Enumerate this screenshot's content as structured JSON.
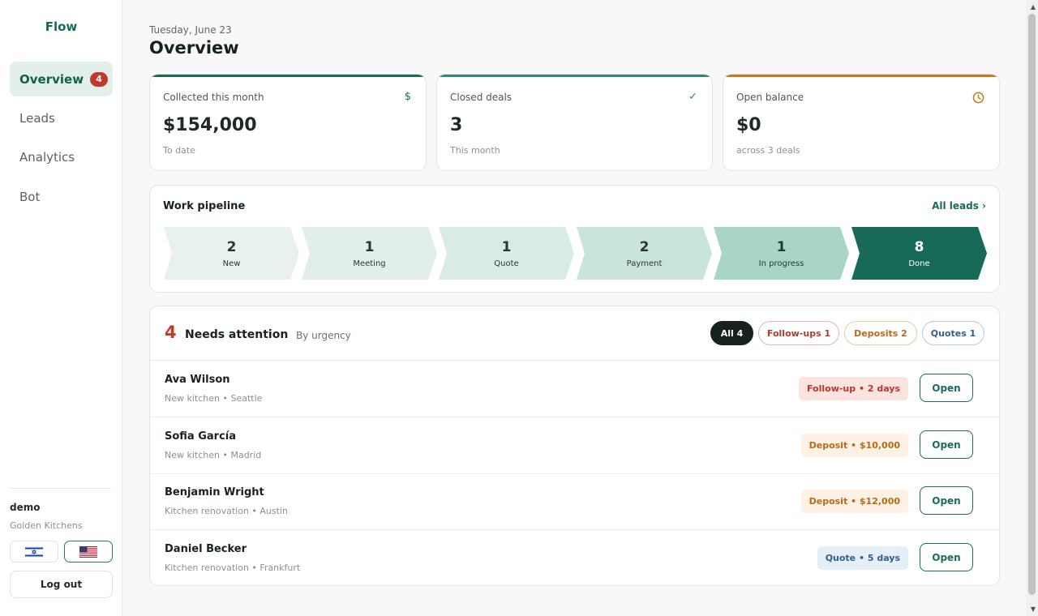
{
  "brand": "Flow",
  "sidebar": {
    "items": [
      {
        "label": "Overview",
        "badge": "4",
        "active": true
      },
      {
        "label": "Leads"
      },
      {
        "label": "Analytics"
      },
      {
        "label": "Bot"
      }
    ],
    "user": {
      "name": "demo",
      "company": "Golden Kitchens"
    },
    "languages": [
      {
        "icon": "israel-flag-icon",
        "selected": false
      },
      {
        "icon": "us-flag-icon",
        "selected": true
      }
    ],
    "logout_label": "Log out"
  },
  "header": {
    "date": "Tuesday, June 23",
    "title": "Overview"
  },
  "kpis": [
    {
      "label": "Collected this month",
      "value": "$154,000",
      "sub": "To date",
      "icon": "dollar-icon",
      "icon_glyph": "$",
      "accent": "#176a58"
    },
    {
      "label": "Closed deals",
      "value": "3",
      "sub": "This month",
      "icon": "check-icon",
      "icon_glyph": "✓",
      "accent": "#2e8b72"
    },
    {
      "label": "Open balance",
      "value": "$0",
      "sub": "across 3 deals",
      "icon": "clock-icon",
      "icon_glyph": "",
      "accent": "#c77a1a"
    }
  ],
  "pipeline": {
    "title": "Work pipeline",
    "link": "All leads ›",
    "stages": [
      {
        "count": "2",
        "label": "New",
        "color": "#e8f1ee"
      },
      {
        "count": "1",
        "label": "Meeting",
        "color": "#e1eee9"
      },
      {
        "count": "1",
        "label": "Quote",
        "color": "#d8ebe4"
      },
      {
        "count": "2",
        "label": "Payment",
        "color": "#c9e4da"
      },
      {
        "count": "1",
        "label": "In progress",
        "color": "#a8d5c7"
      },
      {
        "count": "8",
        "label": "Done",
        "color": "#176a58"
      }
    ]
  },
  "attention": {
    "count": "4",
    "title": "Needs attention",
    "subtitle": "By urgency",
    "filters": [
      {
        "label": "All 4",
        "style": "dark"
      },
      {
        "label": "Follow-ups 1",
        "style": "red"
      },
      {
        "label": "Deposits 2",
        "style": "amber"
      },
      {
        "label": "Quotes 1",
        "style": "blue"
      }
    ],
    "rows": [
      {
        "name": "Ava Wilson",
        "sub": "New kitchen • Seattle",
        "badge": "Follow-up • 2 days",
        "badge_style": "red",
        "action": "Open"
      },
      {
        "name": "Sofia García",
        "sub": "New kitchen • Madrid",
        "badge": "Deposit • $10,000",
        "badge_style": "amber",
        "action": "Open"
      },
      {
        "name": "Benjamin Wright",
        "sub": "Kitchen renovation • Austin",
        "badge": "Deposit • $12,000",
        "badge_style": "amber",
        "action": "Open"
      },
      {
        "name": "Daniel Becker",
        "sub": "Kitchen renovation • Frankfurt",
        "badge": "Quote • 5 days",
        "badge_style": "blue",
        "action": "Open"
      }
    ]
  },
  "colors": {
    "accent": "#176a58",
    "danger": "#c0392b",
    "amber": "#b8691a",
    "blue": "#2f5f8f"
  }
}
